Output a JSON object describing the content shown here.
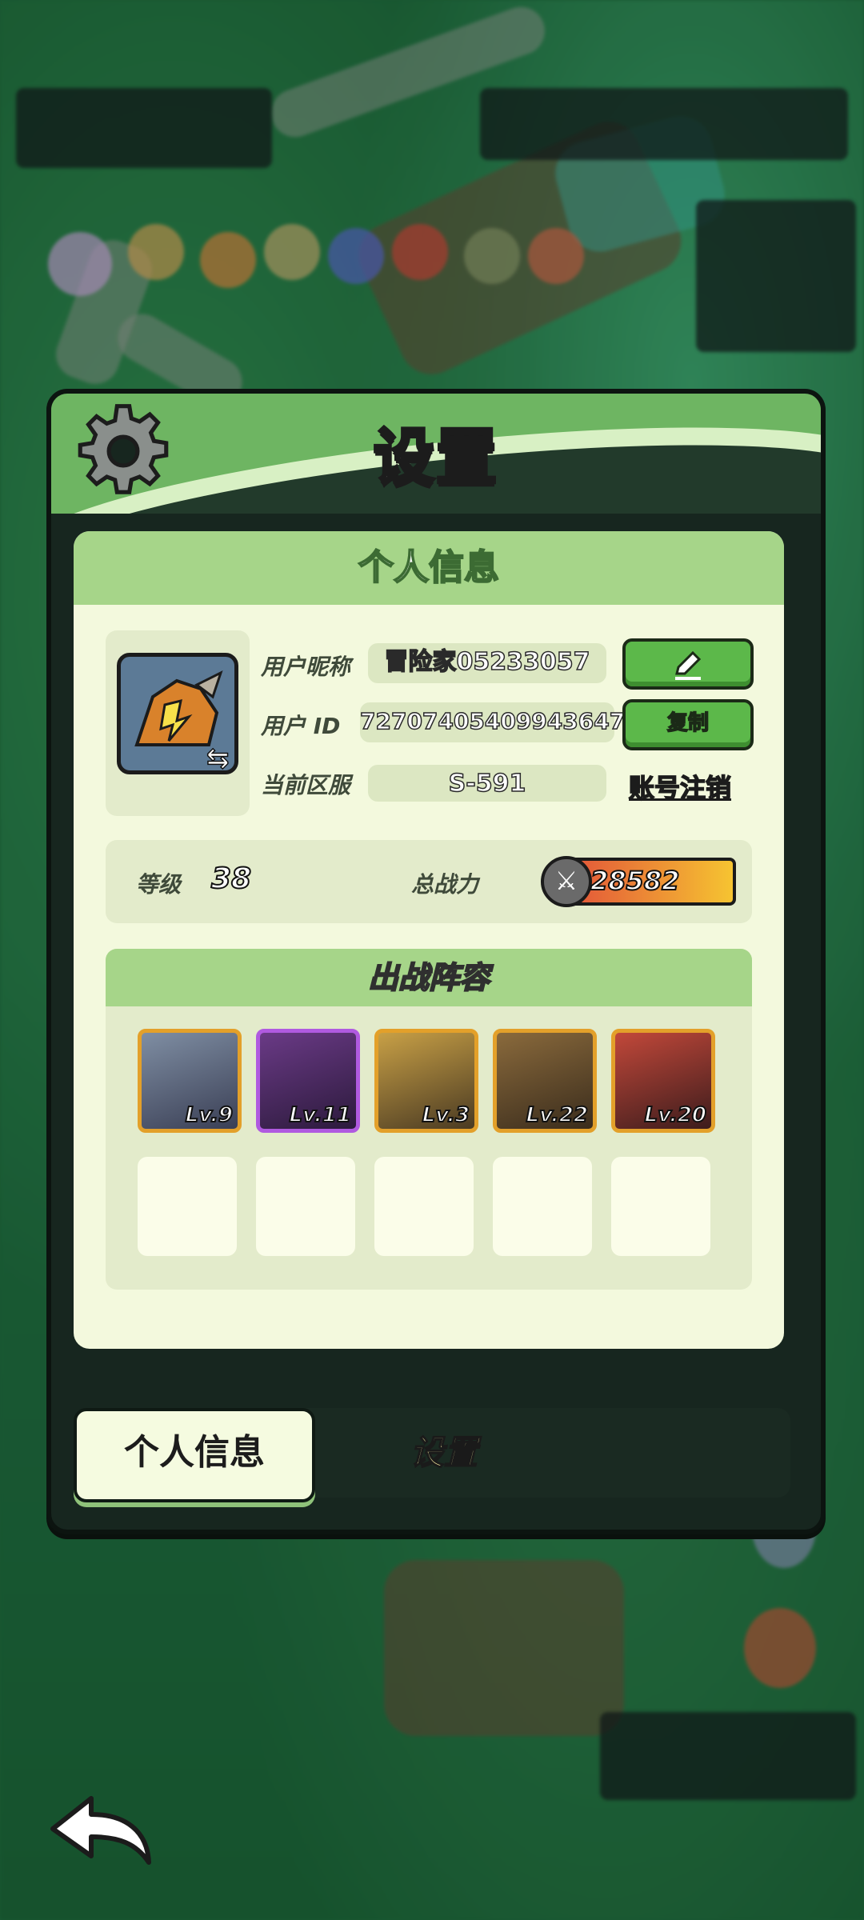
{
  "modal": {
    "title": "设置"
  },
  "panel": {
    "header": "个人信息",
    "labels": {
      "nickname": "用户昵称",
      "user_id": "用户 ID",
      "server": "当前区服"
    },
    "values": {
      "nickname": "冒险家05233057",
      "user_id": "72707405409943647",
      "server": "S-591"
    },
    "buttons": {
      "copy": "复制",
      "unregister": "账号注销",
      "edit_icon": "pencil-icon"
    },
    "stats": {
      "level_label": "等级",
      "level_value": "38",
      "power_label": "总战力",
      "power_value": "28582"
    },
    "lineup": {
      "title": "出战阵容",
      "heroes": [
        {
          "level": "Lv.9",
          "frame": "#e3a02a"
        },
        {
          "level": "Lv.11",
          "frame": "#b05ae0"
        },
        {
          "level": "Lv.3",
          "frame": "#e3a02a"
        },
        {
          "level": "Lv.22",
          "frame": "#e3a02a"
        },
        {
          "level": "Lv.20",
          "frame": "#e3a02a"
        }
      ],
      "empty_slots": 5
    }
  },
  "tabs": {
    "profile": "个人信息",
    "settings": "设置"
  },
  "colors": {
    "accent_green": "#5cb84a",
    "panel_bg": "#f3f9dd",
    "header_green": "#a6d589"
  }
}
